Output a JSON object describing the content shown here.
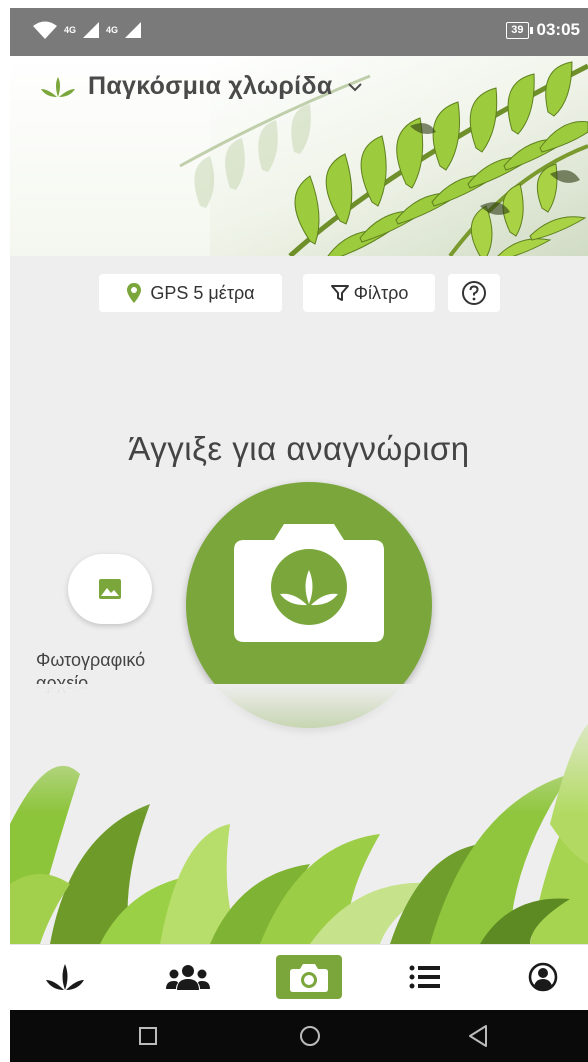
{
  "status_bar": {
    "network_1": "4G",
    "network_2": "4G",
    "battery": "39",
    "time": "03:05",
    "icons": [
      "wifi-icon",
      "signal-icon",
      "signal-icon",
      "battery-icon"
    ]
  },
  "header": {
    "title": "Παγκόσμια χλωρίδα",
    "icons": [
      "leaf-logo-icon",
      "chevron-down-icon"
    ]
  },
  "toolbar": {
    "gps_label": "GPS 5 μέτρα",
    "filter_label": "Φίλτρο",
    "icons": [
      "location-pin-icon",
      "filter-icon",
      "help-icon"
    ]
  },
  "main": {
    "tap_prompt": "Άγγιξε για αναγνώριση",
    "gallery_label_line1": "Φωτογραφικό",
    "gallery_label_line2": "αρχείο",
    "icons": [
      "camera-icon",
      "image-icon"
    ]
  },
  "bottom_nav": {
    "items": [
      {
        "icon": "plants-icon",
        "active": false
      },
      {
        "icon": "community-icon",
        "active": false
      },
      {
        "icon": "camera-icon",
        "active": true
      },
      {
        "icon": "list-icon",
        "active": false
      },
      {
        "icon": "profile-icon",
        "active": false
      }
    ]
  },
  "system_nav": {
    "icons": [
      "recents-icon",
      "home-icon",
      "back-icon"
    ]
  },
  "colors": {
    "accent": "#7aa63b",
    "status_bar": "#7a7a7a",
    "background": "#eeeeee",
    "text": "#444444"
  }
}
